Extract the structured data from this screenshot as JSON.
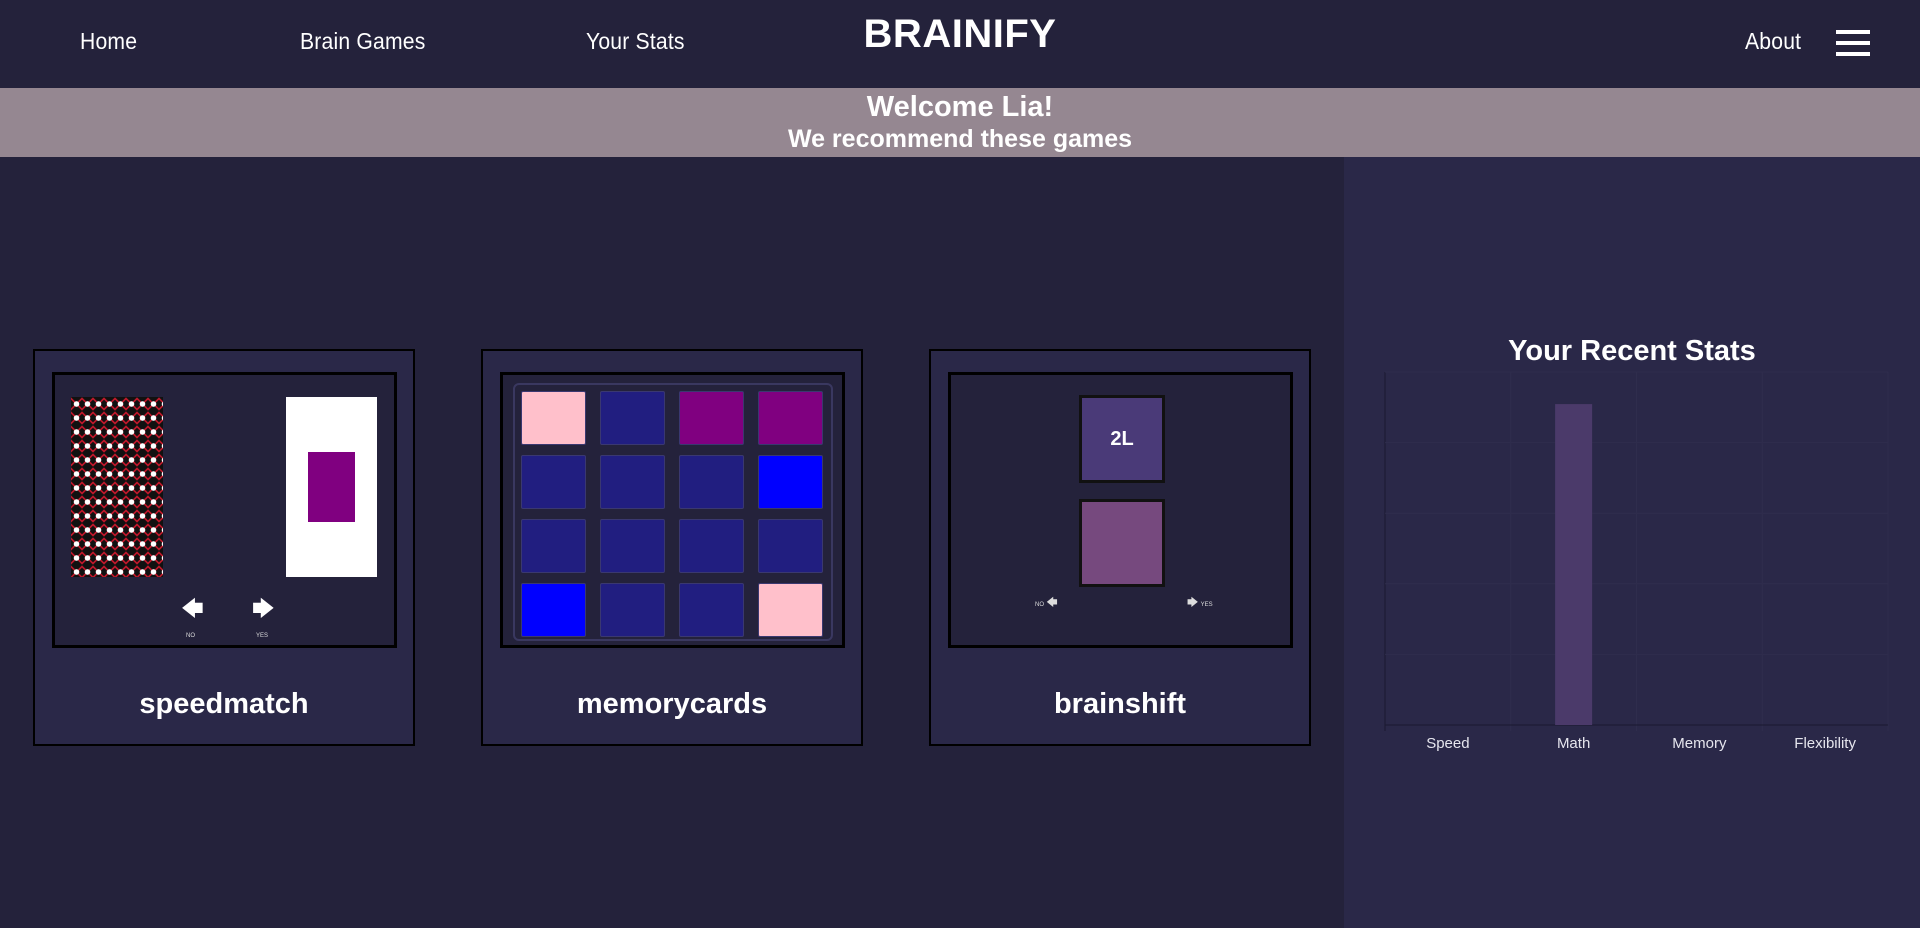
{
  "nav": {
    "home": "Home",
    "brain_games": "Brain Games",
    "your_stats": "Your Stats",
    "brand": "BRAINIFY",
    "about": "About",
    "menu_icon": "hamburger-menu-icon"
  },
  "banner": {
    "welcome": "Welcome Lia!",
    "recommend": "We recommend these games"
  },
  "games": [
    {
      "title": "speedmatch",
      "no": "NO",
      "yes": "YES"
    },
    {
      "title": "memorycards"
    },
    {
      "title": "brainshift",
      "card_label": "2L",
      "no": "NO",
      "yes": "YES"
    }
  ],
  "memory_tiles": [
    [
      "#ffc0cb",
      "#211e80",
      "#800080",
      "#800080"
    ],
    [
      "#211e80",
      "#211e80",
      "#211e80",
      "#0000ff"
    ],
    [
      "#211e80",
      "#211e80",
      "#211e80",
      "#211e80"
    ],
    [
      "#0000ff",
      "#211e80",
      "#211e80",
      "#ffc0cb"
    ]
  ],
  "stats": {
    "title": "Your Recent Stats"
  },
  "chart_data": {
    "type": "bar",
    "title": "Your Recent Stats",
    "categories": [
      "Speed",
      "Math",
      "Memory",
      "Flexibility"
    ],
    "values": [
      0,
      1,
      0,
      0
    ],
    "ylim": [
      0,
      1.1
    ],
    "grid": true,
    "bar_color": "#4b3a6a"
  },
  "colors": {
    "background": "#24223b",
    "panel": "#2a2848",
    "banner": "#958791"
  }
}
